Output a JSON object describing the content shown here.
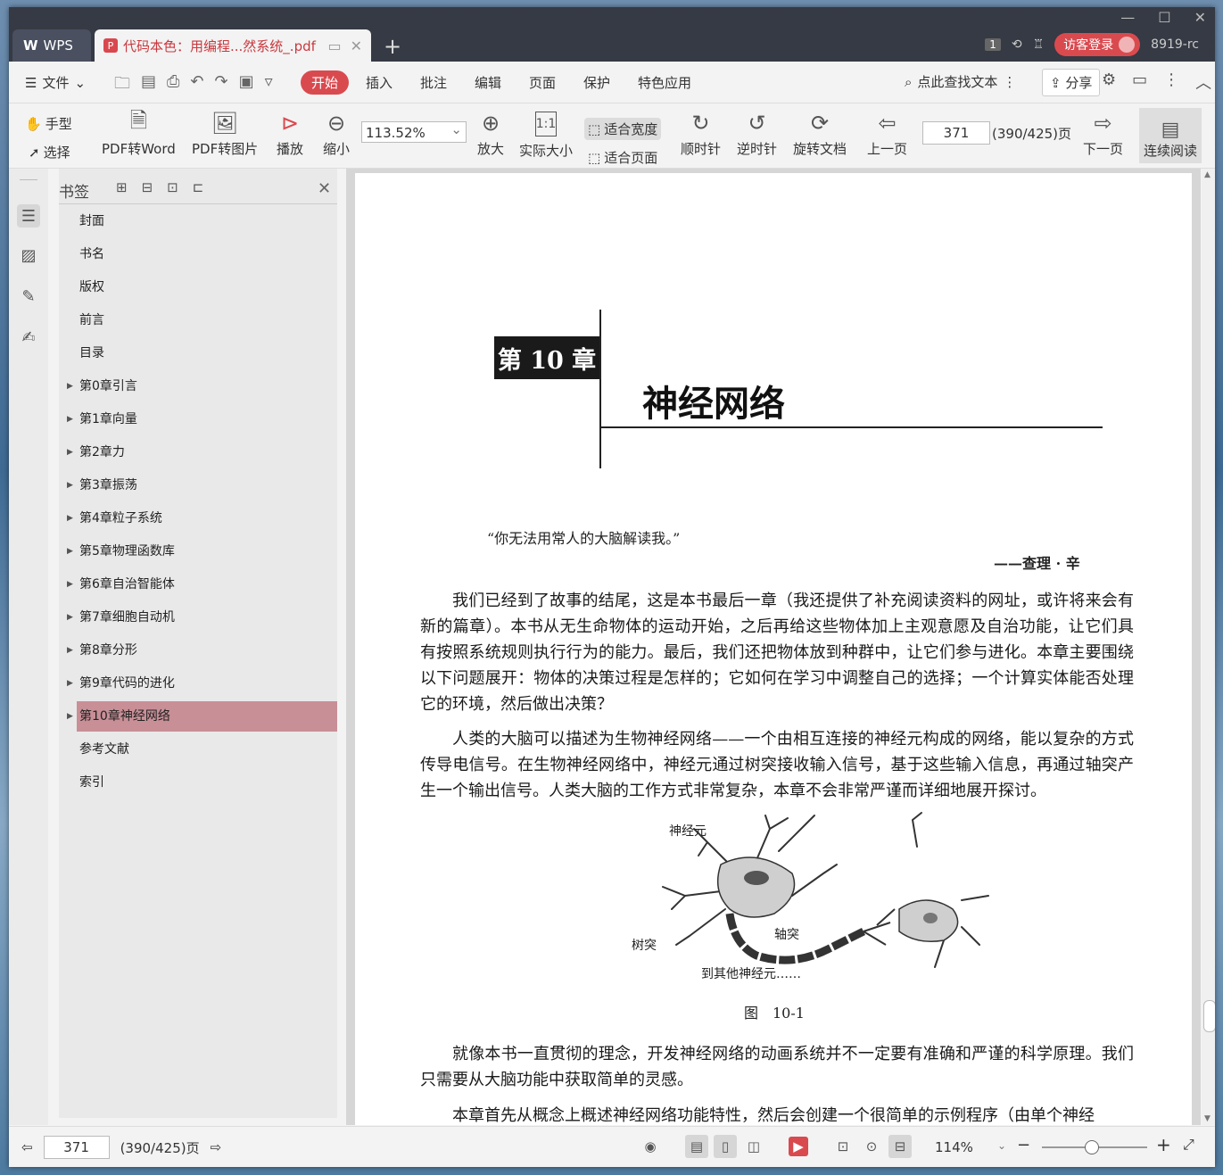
{
  "titlebar": {
    "app_tab": "WPS",
    "doc_tab": "代码本色：用编程...然系统_.pdf",
    "new_tab": "+",
    "page_badge": "1",
    "login": "访客登录",
    "user": "8919-rc"
  },
  "menu": {
    "file": "文件",
    "tabs": [
      "开始",
      "插入",
      "批注",
      "编辑",
      "页面",
      "保护",
      "特色应用"
    ],
    "search": "点此查找文本",
    "share": "分享"
  },
  "toolbar": {
    "hand": "手型",
    "select": "选择",
    "pdf_word": "PDF转Word",
    "pdf_img": "PDF转图片",
    "play": "播放",
    "zoom_out": "缩小",
    "zoom_value": "113.52%",
    "zoom_in": "放大",
    "actual_size": "实际大小",
    "fit_width": "适合宽度",
    "fit_page": "适合页面",
    "clockwise": "顺时针",
    "counterclockwise": "逆时针",
    "rotate_doc": "旋转文档",
    "prev_page": "上一页",
    "page_number": "371",
    "page_total": "(390/425)页",
    "next_page": "下一页",
    "continuous": "连续阅读"
  },
  "bookmarks": {
    "title": "书签",
    "items": [
      {
        "label": "封面",
        "expandable": false
      },
      {
        "label": "书名",
        "expandable": false
      },
      {
        "label": "版权",
        "expandable": false
      },
      {
        "label": "前言",
        "expandable": false
      },
      {
        "label": "目录",
        "expandable": false
      },
      {
        "label": "第0章引言",
        "expandable": true
      },
      {
        "label": "第1章向量",
        "expandable": true
      },
      {
        "label": "第2章力",
        "expandable": true
      },
      {
        "label": "第3章振荡",
        "expandable": true
      },
      {
        "label": "第4章粒子系统",
        "expandable": true
      },
      {
        "label": "第5章物理函数库",
        "expandable": true
      },
      {
        "label": "第6章自治智能体",
        "expandable": true
      },
      {
        "label": "第7章细胞自动机",
        "expandable": true
      },
      {
        "label": "第8章分形",
        "expandable": true
      },
      {
        "label": "第9章代码的进化",
        "expandable": true
      },
      {
        "label": "第10章神经网络",
        "expandable": true,
        "selected": true
      },
      {
        "label": "参考文献",
        "expandable": false
      },
      {
        "label": "索引",
        "expandable": false
      }
    ]
  },
  "page": {
    "chapter_badge": "第 10 章",
    "chapter_title": "神经网络",
    "quote": "“你无法用常人的大脑解读我。”",
    "author": "——查理 · 辛",
    "para1": "我们已经到了故事的结尾，这是本书最后一章（我还提供了补充阅读资料的网址，或许将来会有新的篇章）。本书从无生命物体的运动开始，之后再给这些物体加上主观意愿及自治功能，让它们具有按照系统规则执行行为的能力。最后，我们还把物体放到种群中，让它们参与进化。本章主要围绕以下问题展开：物体的决策过程是怎样的；它如何在学习中调整自己的选择；一个计算实体能否处理它的环境，然后做出决策？",
    "para2": "人类的大脑可以描述为生物神经网络——一个由相互连接的神经元构成的网络，能以复杂的方式传导电信号。在生物神经网络中，神经元通过树突接收输入信号，基于这些输入信息，再通过轴突产生一个输出信号。人类大脑的工作方式非常复杂，本章不会非常严谨而详细地展开探讨。",
    "fig_neuron": "神经元",
    "fig_dendrite": "树突",
    "fig_axon": "轴突",
    "fig_other": "到其他神经元……",
    "caption": "图　10-1",
    "para3": "就像本书一直贯彻的理念，开发神经网络的动画系统并不一定要有准确和严谨的科学原理。我们只需要从大脑功能中获取简单的灵感。",
    "para4": "本章首先从概念上概述神经网络功能特性，然后会创建一个很简单的示例程序（由单个神经"
  },
  "status": {
    "page_number": "371",
    "page_total": "(390/425)页",
    "zoom": "114%"
  }
}
